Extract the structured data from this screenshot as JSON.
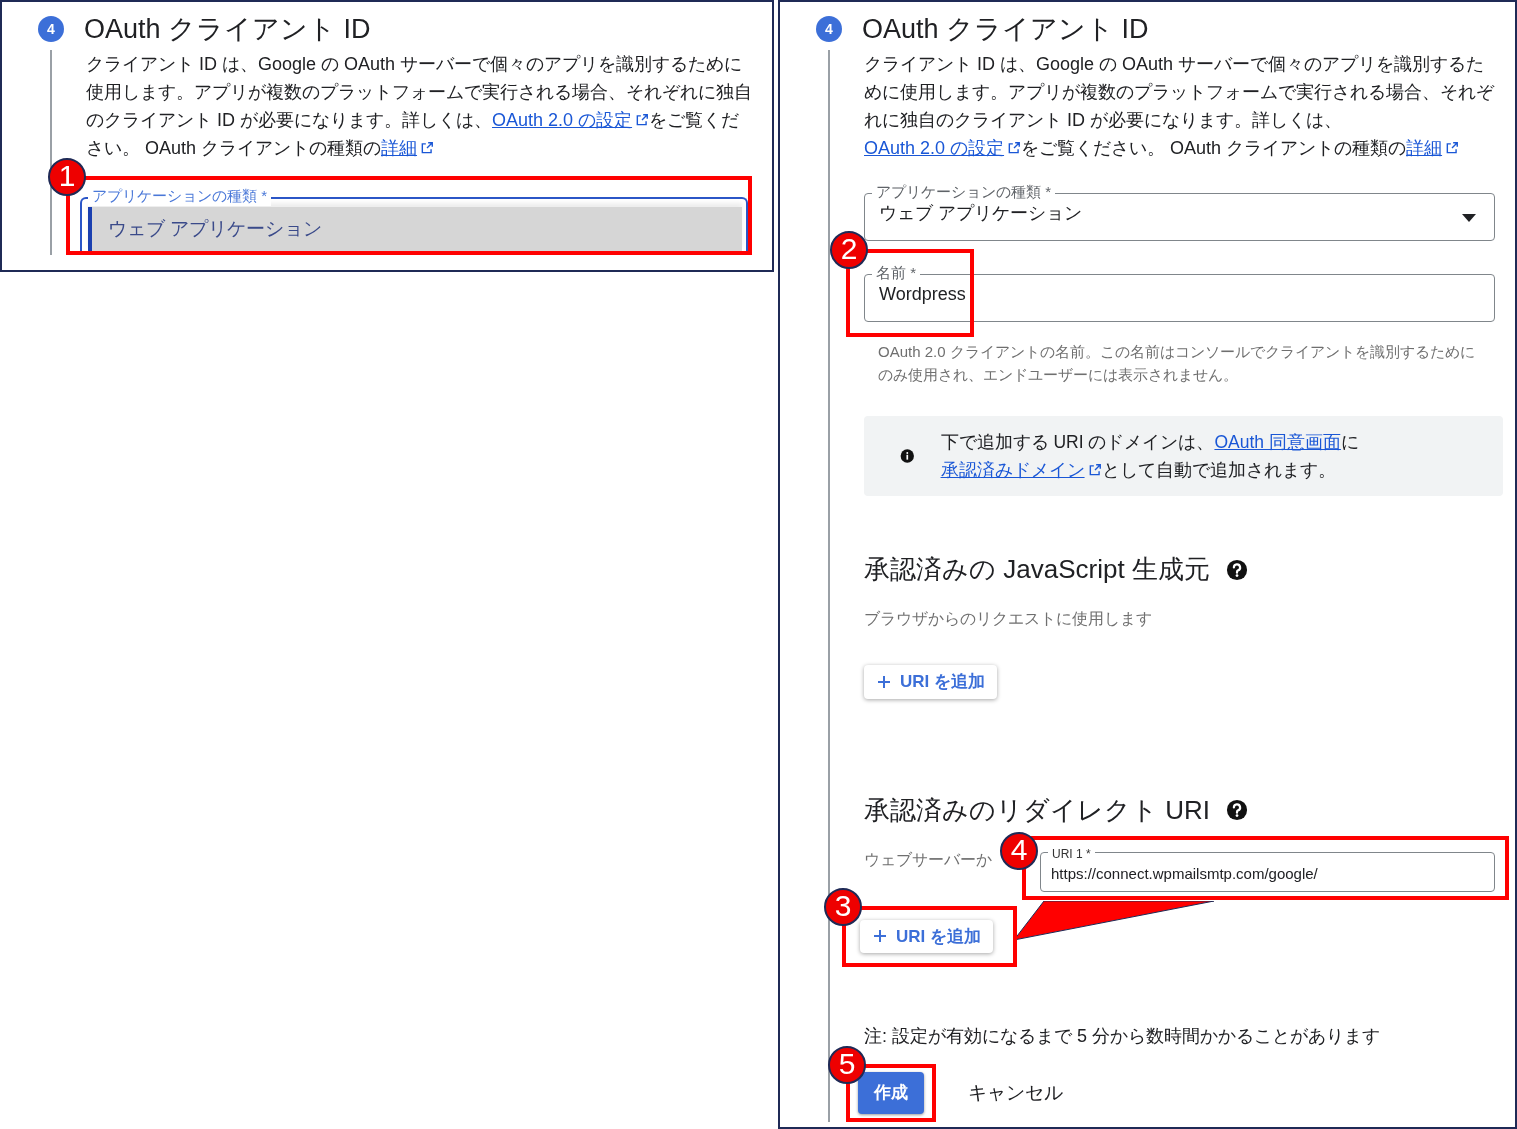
{
  "panels": [
    {
      "step": "4",
      "title": "OAuth クライアント ID",
      "description": [
        {
          "kind": "text",
          "text": "クライアント ID は、Google の OAuth サーバーで個々のアプリを識別するために使用します。アプリが複数のプラットフォームで実行される場合、それぞれに独自のクライアント ID が必要になります。詳しくは、"
        },
        {
          "kind": "link",
          "text": "OAuth 2.0 の設定",
          "external": true
        },
        {
          "kind": "text",
          "text": "をご覧ください。 OAuth クライアントの種類の"
        },
        {
          "kind": "link",
          "text": "詳細",
          "external": true
        }
      ],
      "app_type": {
        "label": "アプリケーションの種類 *",
        "value": "ウェブ アプリケーション",
        "expanded": true,
        "marker": "1"
      }
    },
    {
      "step": "4",
      "title": "OAuth クライアント ID",
      "description": [
        {
          "kind": "text",
          "text": "クライアント ID は、Google の OAuth サーバーで個々のアプリを識別するために使用します。アプリが複数のプラットフォームで実行される場合、それぞれに独自のクライアント ID が必要になります。詳しくは、"
        },
        {
          "kind": "link",
          "text": "OAuth 2.0 の設定",
          "external": true
        },
        {
          "kind": "text",
          "text": "をご覧ください。 OAuth クライアントの種類の"
        },
        {
          "kind": "link",
          "text": "詳細",
          "external": true
        }
      ],
      "app_type": {
        "label": "アプリケーションの種類 *",
        "value": "ウェブ アプリケーション",
        "expanded": false
      },
      "name_field": {
        "label": "名前 *",
        "value": "Wordpress",
        "marker": "2",
        "hint": "OAuth 2.0 クライアントの名前。この名前はコンソールでクライアントを識別するためにのみ使用され、エンドユーザーには表示されません。"
      },
      "notice": [
        {
          "kind": "text",
          "text": "下で追加する URI のドメインは、"
        },
        {
          "kind": "link",
          "text": "OAuth 同意画面",
          "external": false
        },
        {
          "kind": "text",
          "text": "に"
        },
        {
          "kind": "link",
          "text": "承認済みドメイン",
          "external": true
        },
        {
          "kind": "text",
          "text": "として自動で追加されます。"
        }
      ],
      "sections": [
        {
          "title": "承認済みの JavaScript 生成元",
          "subtitle": "ブラウザからのリクエストに使用します",
          "add_button": "URI を追加"
        },
        {
          "title": "承認済みのリダイレクト URI",
          "subtitle": "ウェブサーバーか",
          "uris": [
            {
              "label": "URI 1 *",
              "value": "https://connect.wpmailsmtp.com/google/",
              "marker": "4"
            }
          ],
          "add_button": "URI を追加",
          "add_marker": "3"
        }
      ],
      "note": "注: 設定が有効になるまで 5 分から数時間かかることがあります",
      "create_button": "作成",
      "create_marker": "5",
      "cancel_button": "キャンセル"
    }
  ]
}
